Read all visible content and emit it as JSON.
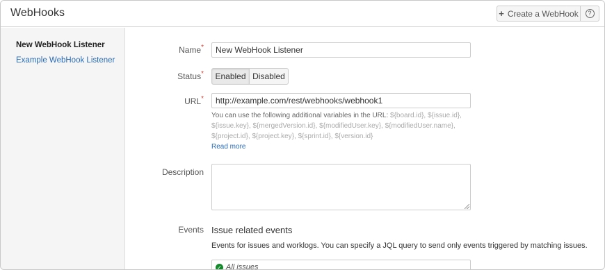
{
  "header": {
    "title": "WebHooks",
    "create_label": "Create a WebHook",
    "help_label": "?"
  },
  "sidebar": {
    "items": [
      {
        "label": "New WebHook Listener",
        "active": true
      },
      {
        "label": "Example WebHook Listener",
        "active": false
      }
    ]
  },
  "form": {
    "name": {
      "label": "Name",
      "required_mark": "*",
      "value": "New WebHook Listener"
    },
    "status": {
      "label": "Status",
      "required_mark": "*",
      "options": [
        "Enabled",
        "Disabled"
      ],
      "selected": "Enabled"
    },
    "url": {
      "label": "URL",
      "required_mark": "*",
      "value": "http://example.com/rest/webhooks/webhook1",
      "help_intro": "You can use the following additional variables in the URL:",
      "variables": "${board.id}, ${issue.id}, ${issue.key}, ${mergedVersion.id}, ${modifiedUser.key}, ${modifiedUser.name}, ${project.id}, ${project.key}, ${sprint.id}, ${version.id}",
      "read_more": "Read more"
    },
    "description": {
      "label": "Description",
      "value": ""
    },
    "events": {
      "label": "Events",
      "section_title": "Issue related events",
      "section_desc": "Events for issues and worklogs. You can specify a JQL query to send only events triggered by matching issues.",
      "jql_value": "All issues"
    }
  },
  "colors": {
    "link": "#2a6bb5",
    "required": "#d04437",
    "sidebar_bg": "#f5f5f5",
    "check_green": "#14892c"
  }
}
